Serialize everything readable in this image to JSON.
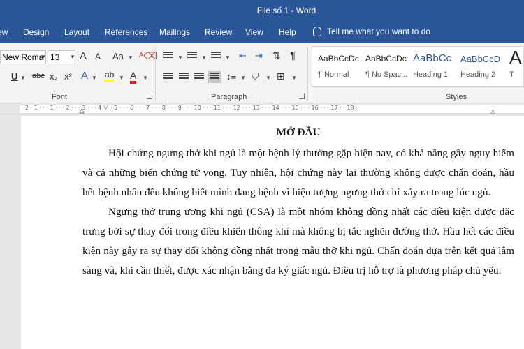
{
  "window": {
    "title": "File số 1 - Word"
  },
  "ribbon_tabs": [
    "ew",
    "Design",
    "Layout",
    "References",
    "Mailings",
    "Review",
    "View",
    "Help"
  ],
  "tell_me": "Tell me what you want to do",
  "font": {
    "name": "New Roma",
    "size": "13",
    "grow": "A",
    "shrink": "A",
    "change_case": "Aa",
    "underline": "U",
    "strikethrough": "abc",
    "subscript": "x₂",
    "superscript": "x²",
    "effects": "A",
    "highlight": "ab",
    "color": "A",
    "group_label": "Font"
  },
  "paragraph": {
    "pilcrow": "¶",
    "group_label": "Paragraph"
  },
  "styles": {
    "items": [
      {
        "sample": "AaBbCcDc",
        "name": "¶ Normal"
      },
      {
        "sample": "AaBbCcDc",
        "name": "¶ No Spac..."
      },
      {
        "sample": "AaBbCc",
        "name": "Heading 1"
      },
      {
        "sample": "AaBbCcD",
        "name": "Heading 2"
      },
      {
        "sample": "A",
        "name": "T"
      }
    ],
    "group_label": "Styles"
  },
  "ruler": {
    "text": "2 · 1 · · · 1 · · · 2 · · · 3 · · · 4 · · · 5 · · · 6 · · · 7 · · · 8 · · · 9 · · · 10 · · · 11 · · · 12 · · · 13 · · · 14 · · · 15 · · · 16 · · · 17 · · 18 ·"
  },
  "document": {
    "heading": "MỞ ĐẦU",
    "paragraphs": [
      "Hội chứng ngưng thở khi ngủ là một bệnh lý thường gặp hiện nay, có khả năng gây nguy hiểm và cả những biến chứng tử vong. Tuy nhiên, hội chứng này lại thường không được chẩn đoán, hầu hết bệnh nhân đều không biết mình đang bệnh vì hiện tượng ngưng thở chỉ xảy ra trong lúc ngủ.",
      "Ngưng thở trung ương khi ngủ (CSA) là một nhóm không đồng nhất các điều kiện được đặc trưng bởi sự thay đổi trong điều khiển thông khí mà không bị tắc nghẽn đường thở. Hầu hết các điều kiện này gây ra sự thay đổi không đồng nhất trong mẫu thở khi ngủ. Chẩn đoán dựa trên kết quả lâm sàng và, khi cần thiết, được xác nhận bằng đa ký giấc ngủ. Điều trị hỗ trợ là phương pháp chủ yếu."
    ]
  }
}
